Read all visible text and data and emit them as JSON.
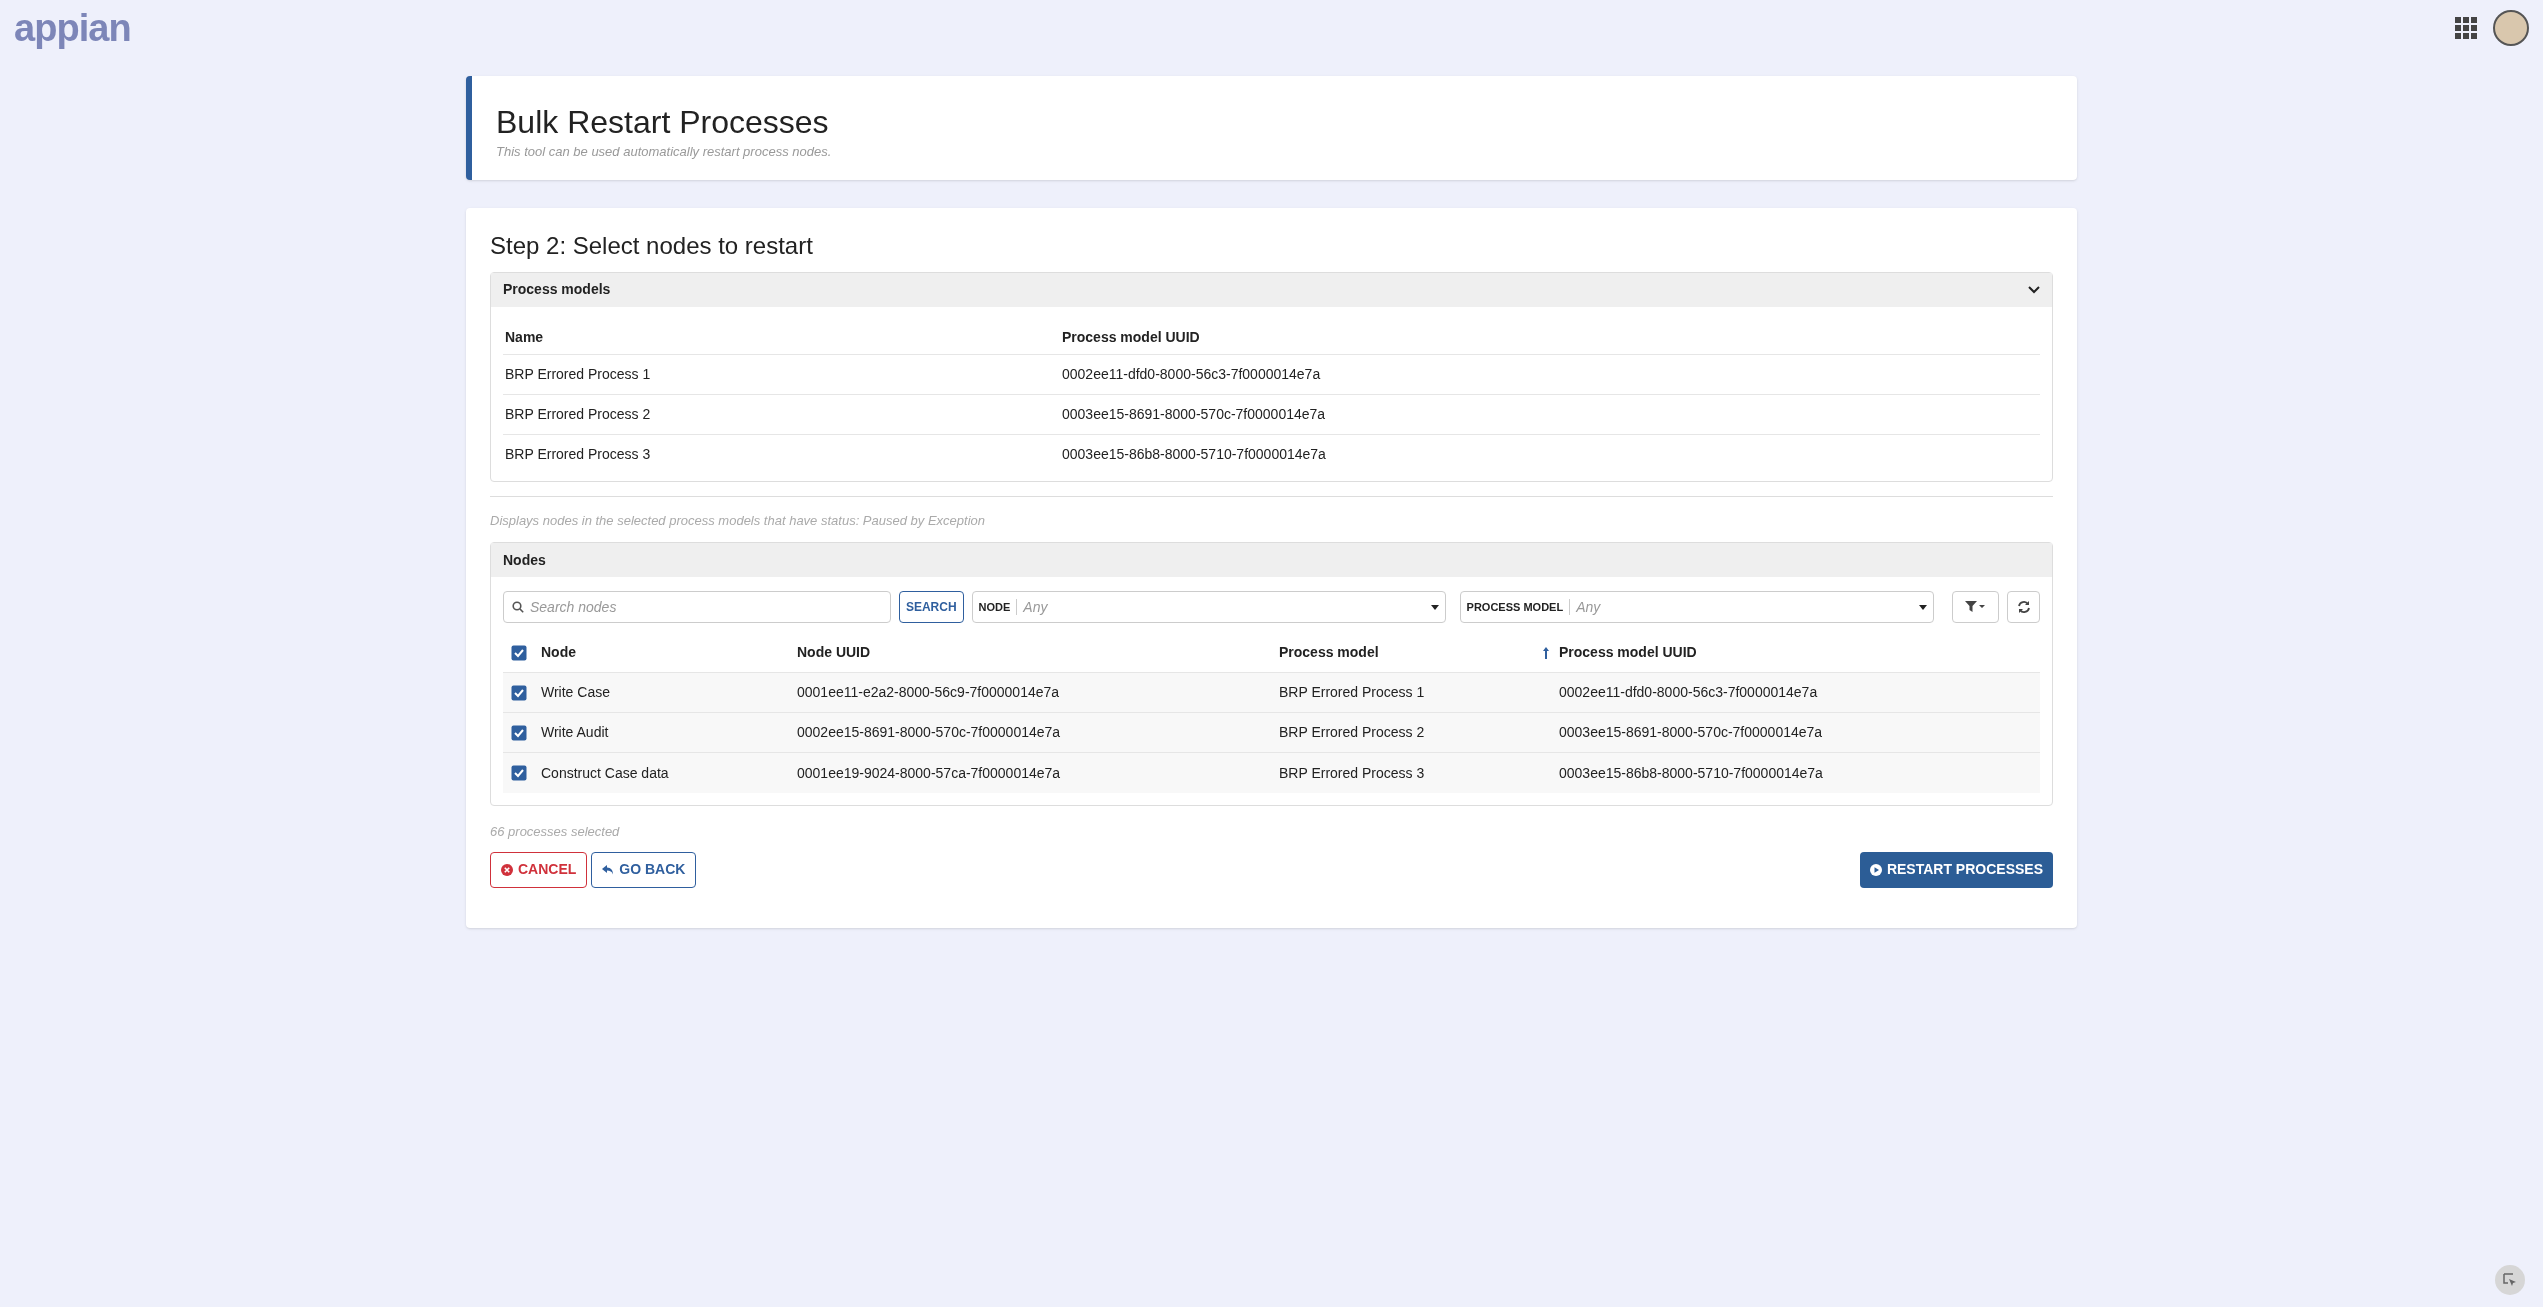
{
  "top_bar": {
    "logo": "appian"
  },
  "header": {
    "title": "Bulk Restart Processes",
    "subtitle": "This tool can be used automatically restart process nodes."
  },
  "step_title": "Step 2: Select nodes to restart",
  "process_models": {
    "title": "Process models",
    "expanded": true,
    "columns": [
      "Name",
      "Process model UUID"
    ],
    "rows": [
      {
        "name": "BRP Errored Process 1",
        "uuid": "0002ee11-dfd0-8000-56c3-7f0000014e7a"
      },
      {
        "name": "BRP Errored Process 2",
        "uuid": "0003ee15-8691-8000-570c-7f0000014e7a"
      },
      {
        "name": "BRP Errored Process 3",
        "uuid": "0003ee15-86b8-8000-5710-7f0000014e7a"
      }
    ]
  },
  "hint": "Displays nodes in the selected process models that have status: Paused by Exception",
  "nodes": {
    "title": "Nodes",
    "search": {
      "placeholder": "Search nodes",
      "button": "SEARCH"
    },
    "filters": [
      {
        "label": "NODE",
        "value": "Any"
      },
      {
        "label": "PROCESS MODEL",
        "value": "Any"
      }
    ],
    "select_all_checked": true,
    "columns": [
      {
        "label": "Node",
        "sorted": false
      },
      {
        "label": "Node UUID",
        "sorted": false
      },
      {
        "label": "Process model",
        "sorted": true
      },
      {
        "label": "Process model UUID",
        "sorted": false
      }
    ],
    "rows": [
      {
        "checked": true,
        "cells": [
          "Write Case",
          "0001ee11-e2a2-8000-56c9-7f0000014e7a",
          "BRP Errored Process 1",
          "0002ee11-dfd0-8000-56c3-7f0000014e7a"
        ]
      },
      {
        "checked": true,
        "cells": [
          "Write Audit",
          "0002ee15-8691-8000-570c-7f0000014e7a",
          "BRP Errored Process 2",
          "0003ee15-8691-8000-570c-7f0000014e7a"
        ]
      },
      {
        "checked": true,
        "cells": [
          "Construct Case data",
          "0001ee19-9024-8000-57ca-7f0000014e7a",
          "BRP Errored Process 3",
          "0003ee15-86b8-8000-5710-7f0000014e7a"
        ]
      }
    ]
  },
  "selection_count": "66 processes selected",
  "buttons": [
    {
      "kind": "cancel",
      "label": "CANCEL"
    },
    {
      "kind": "back",
      "label": "GO BACK"
    },
    {
      "kind": "primary",
      "label": "RESTART PROCESSES"
    }
  ]
}
